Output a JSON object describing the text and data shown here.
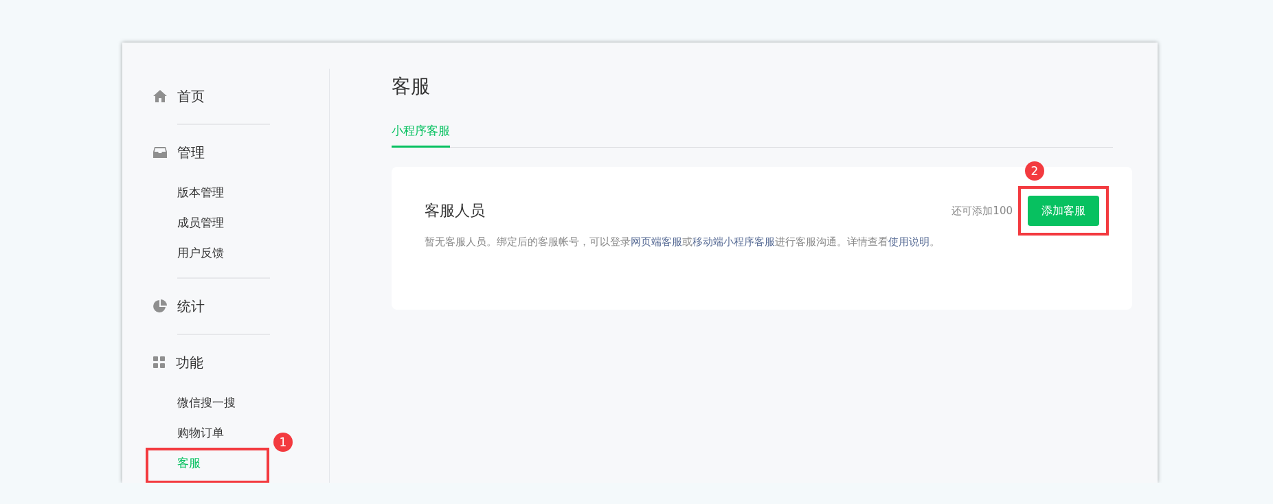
{
  "sidebar": {
    "sections": [
      {
        "label": "首页",
        "selected": false
      },
      {
        "label": "管理",
        "selected": false,
        "items": [
          {
            "label": "版本管理",
            "selected": false
          },
          {
            "label": "成员管理",
            "selected": false
          },
          {
            "label": "用户反馈",
            "selected": false
          }
        ]
      },
      {
        "label": "统计",
        "selected": false
      },
      {
        "label": "功能",
        "selected": false,
        "items": [
          {
            "label": "微信搜一搜",
            "selected": false
          },
          {
            "label": "购物订单",
            "selected": false
          },
          {
            "label": "客服",
            "selected": true,
            "annotation": "1"
          }
        ]
      }
    ]
  },
  "page_title": "客服",
  "tabs": [
    {
      "label": "小程序客服",
      "selected": true
    }
  ],
  "card": {
    "title": "客服人员",
    "quota": "还可添加100",
    "button": {
      "label": "添加客服",
      "annotation": "2"
    },
    "description": [
      {
        "kind": "text",
        "text": "暂无客服人员。绑定后的客服帐号，可以登录"
      },
      {
        "kind": "link",
        "text": "网页端客服"
      },
      {
        "kind": "text",
        "text": "或"
      },
      {
        "kind": "link",
        "text": "移动端小程序客服"
      },
      {
        "kind": "text",
        "text": "进行客服沟通。详情查看"
      },
      {
        "kind": "link",
        "text": "使用说明"
      },
      {
        "kind": "text",
        "text": "。"
      }
    ]
  }
}
